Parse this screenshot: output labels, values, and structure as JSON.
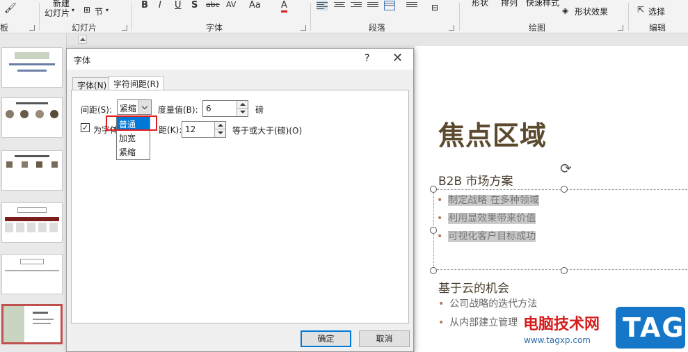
{
  "ribbon": {
    "clipboard_group": "板",
    "new_slide_top": "新建",
    "new_slide_bottom": "幻灯片",
    "section_btn": "节",
    "slides_group": "幻灯片",
    "font_group": "字体",
    "paragraph_group": "段落",
    "shape_btn": "形状",
    "arrange_btn": "排列",
    "quick_styles_btn": "快速样式",
    "shape_effects_btn": "形状效果",
    "drawing_group": "绘图",
    "select_btn": "选择",
    "editing_group": "编辑",
    "bold": "B",
    "italic": "I",
    "underline": "U",
    "shadow": "S",
    "strike": "abc",
    "spacing": "AV",
    "case": "Aa",
    "font_color": "A",
    "font_color_hex": "#e21d1d"
  },
  "slide": {
    "title": "焦点区域",
    "section1_heading": "B2B 市场方案",
    "section1_bullets": [
      "制定战略 在多种领域",
      "利用显效果带来价值",
      "可视化客户目标成功"
    ],
    "section2_heading": "基于云的机会",
    "section2_bullets": [
      "公司战略的迭代方法",
      "从内部建立管理"
    ]
  },
  "dialog": {
    "title": "字体",
    "help": "?",
    "close": "✕",
    "tab_font": "字体(N)",
    "tab_spacing": "字符间距(R)",
    "spacing_label": "间距(S):",
    "spacing_value": "紧缩",
    "measure_label": "度量值(B):",
    "measure_value": "6",
    "unit_label": "磅",
    "kerning_label_prefix": "为字体",
    "kerning_label_suffix": "距(K):",
    "kerning_value": "12",
    "kerning_suffix": "等于或大于(磅)(O)",
    "kerning_checked": "✓",
    "options": [
      "普通",
      "加宽",
      "紧缩"
    ],
    "ok": "确定",
    "cancel": "取消"
  },
  "watermark": {
    "site_name": "电脑技术网",
    "url": "www.tagxp.com",
    "logo": "TAG"
  }
}
